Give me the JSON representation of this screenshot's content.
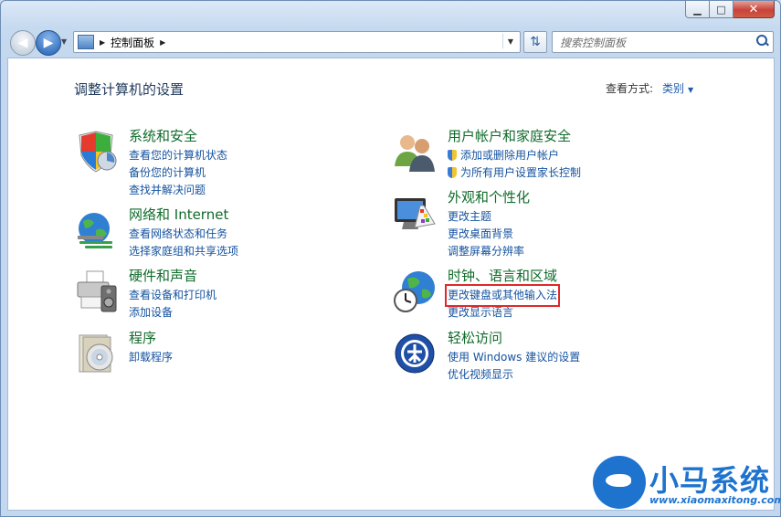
{
  "window": {
    "caption_buttons": {
      "minimize": "▁",
      "maximize": "□",
      "close": "✕"
    }
  },
  "address_bar": {
    "breadcrumb": "控制面板",
    "icon": "control-panel-icon"
  },
  "search": {
    "placeholder": "搜索控制面板"
  },
  "main": {
    "heading": "调整计算机的设置",
    "view_by_label": "查看方式:",
    "view_by_value": "类别"
  },
  "categories": [
    {
      "title": "系统和安全",
      "icon": "security-shield-icon",
      "links": [
        "查看您的计算机状态",
        "备份您的计算机",
        "查找并解决问题"
      ]
    },
    {
      "title": "网络和 Internet",
      "icon": "network-globe-icon",
      "links": [
        "查看网络状态和任务",
        "选择家庭组和共享选项"
      ]
    },
    {
      "title": "硬件和声音",
      "icon": "printer-speaker-icon",
      "links": [
        "查看设备和打印机",
        "添加设备"
      ]
    },
    {
      "title": "程序",
      "icon": "programs-disc-icon",
      "links": [
        "卸载程序"
      ]
    },
    {
      "title": "用户帐户和家庭安全",
      "icon": "users-icon",
      "links": [
        "添加或删除用户帐户",
        "为所有用户设置家长控制"
      ]
    },
    {
      "title": "外观和个性化",
      "icon": "monitor-palette-icon",
      "links": [
        "更改主题",
        "更改桌面背景",
        "调整屏幕分辨率"
      ]
    },
    {
      "title": "时钟、语言和区域",
      "icon": "clock-globe-icon",
      "links": [
        "更改键盘或其他输入法",
        "更改显示语言"
      ]
    },
    {
      "title": "轻松访问",
      "icon": "ease-of-access-icon",
      "links": [
        "使用 Windows 建议的设置",
        "优化视频显示"
      ]
    }
  ],
  "watermark": {
    "text": "小马系统",
    "url": "www.xiaomaxitong.com"
  },
  "colors": {
    "category_title": "#0f6b2a",
    "link": "#1553a0",
    "highlight": "#e0282a"
  }
}
